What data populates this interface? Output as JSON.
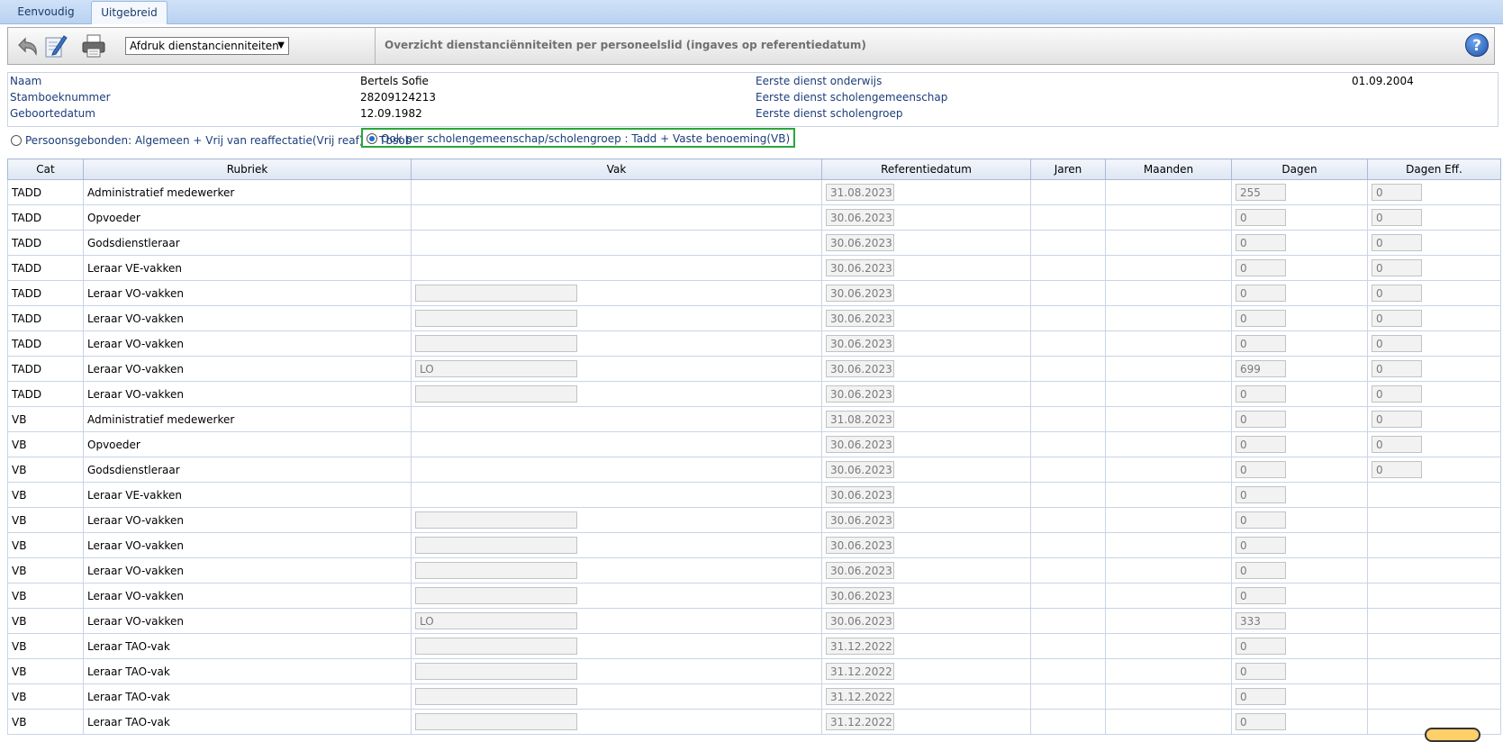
{
  "tabs": [
    {
      "label": "Eenvoudig"
    },
    {
      "label": "Uitgebreid"
    }
  ],
  "toolbar": {
    "report_select": "Afdruk dienstancienniteiten",
    "title": "Overzicht dienstanciënniteiten per personeelslid (ingaves op referentiedatum)",
    "help": "?"
  },
  "info": {
    "naam_label": "Naam",
    "naam_value": "Bertels Sofie",
    "stamboek_label": "Stamboeknummer",
    "stamboek_value": "28209124213",
    "geboorte_label": "Geboortedatum",
    "geboorte_value": "12.09.1982",
    "eerste_onderwijs_label": "Eerste dienst onderwijs",
    "eerste_onderwijs_value": "01.09.2004",
    "eerste_scholengemeenschap_label": "Eerste dienst scholengemeenschap",
    "eerste_scholengroep_label": "Eerste dienst scholengroep"
  },
  "radios": {
    "option1": "Persoonsgebonden: Algemeen + Vrij van reaffectatie(Vrij reaf) + Tbsob",
    "option2": "Ook per scholengemeenschap/scholengroep : Tadd + Vaste benoeming(VB)"
  },
  "columns": [
    "Cat",
    "Rubriek",
    "Vak",
    "Referentiedatum",
    "Jaren",
    "Maanden",
    "Dagen",
    "Dagen Eff."
  ],
  "rows": [
    {
      "cat": "TADD",
      "rubriek": "Administratief medewerker",
      "vak": null,
      "ref": "31.08.2023",
      "dagen": "255",
      "eff": "0"
    },
    {
      "cat": "TADD",
      "rubriek": "Opvoeder",
      "vak": null,
      "ref": "30.06.2023",
      "dagen": "0",
      "eff": "0"
    },
    {
      "cat": "TADD",
      "rubriek": "Godsdienstleraar",
      "vak": null,
      "ref": "30.06.2023",
      "dagen": "0",
      "eff": "0"
    },
    {
      "cat": "TADD",
      "rubriek": "Leraar VE-vakken",
      "vak": null,
      "ref": "30.06.2023",
      "dagen": "0",
      "eff": "0"
    },
    {
      "cat": "TADD",
      "rubriek": "Leraar VO-vakken",
      "vak": "",
      "ref": "30.06.2023",
      "dagen": "0",
      "eff": "0"
    },
    {
      "cat": "TADD",
      "rubriek": "Leraar VO-vakken",
      "vak": "",
      "ref": "30.06.2023",
      "dagen": "0",
      "eff": "0"
    },
    {
      "cat": "TADD",
      "rubriek": "Leraar VO-vakken",
      "vak": "",
      "ref": "30.06.2023",
      "dagen": "0",
      "eff": "0"
    },
    {
      "cat": "TADD",
      "rubriek": "Leraar VO-vakken",
      "vak": "LO",
      "ref": "30.06.2023",
      "dagen": "699",
      "eff": "0"
    },
    {
      "cat": "TADD",
      "rubriek": "Leraar VO-vakken",
      "vak": "",
      "ref": "30.06.2023",
      "dagen": "0",
      "eff": "0"
    },
    {
      "cat": "VB",
      "rubriek": "Administratief medewerker",
      "vak": null,
      "ref": "31.08.2023",
      "dagen": "0",
      "eff": "0"
    },
    {
      "cat": "VB",
      "rubriek": "Opvoeder",
      "vak": null,
      "ref": "30.06.2023",
      "dagen": "0",
      "eff": "0"
    },
    {
      "cat": "VB",
      "rubriek": "Godsdienstleraar",
      "vak": null,
      "ref": "30.06.2023",
      "dagen": "0",
      "eff": "0"
    },
    {
      "cat": "VB",
      "rubriek": "Leraar VE-vakken",
      "vak": null,
      "ref": "30.06.2023",
      "dagen": "0",
      "eff": null
    },
    {
      "cat": "VB",
      "rubriek": "Leraar VO-vakken",
      "vak": "",
      "ref": "30.06.2023",
      "dagen": "0",
      "eff": null
    },
    {
      "cat": "VB",
      "rubriek": "Leraar VO-vakken",
      "vak": "",
      "ref": "30.06.2023",
      "dagen": "0",
      "eff": null
    },
    {
      "cat": "VB",
      "rubriek": "Leraar VO-vakken",
      "vak": "",
      "ref": "30.06.2023",
      "dagen": "0",
      "eff": null
    },
    {
      "cat": "VB",
      "rubriek": "Leraar VO-vakken",
      "vak": "",
      "ref": "30.06.2023",
      "dagen": "0",
      "eff": null
    },
    {
      "cat": "VB",
      "rubriek": "Leraar VO-vakken",
      "vak": "LO",
      "ref": "30.06.2023",
      "dagen": "333",
      "eff": null
    },
    {
      "cat": "VB",
      "rubriek": "Leraar TAO-vak",
      "vak": "",
      "ref": "31.12.2022",
      "dagen": "0",
      "eff": null
    },
    {
      "cat": "VB",
      "rubriek": "Leraar TAO-vak",
      "vak": "",
      "ref": "31.12.2022",
      "dagen": "0",
      "eff": null
    },
    {
      "cat": "VB",
      "rubriek": "Leraar TAO-vak",
      "vak": "",
      "ref": "31.12.2022",
      "dagen": "0",
      "eff": null
    },
    {
      "cat": "VB",
      "rubriek": "Leraar TAO-vak",
      "vak": "",
      "ref": "31.12.2022",
      "dagen": "0",
      "eff": null
    }
  ],
  "colors": {
    "accent": "#2aa63a",
    "label": "#1c3d7a",
    "tabbar": "#b9d2f1"
  }
}
